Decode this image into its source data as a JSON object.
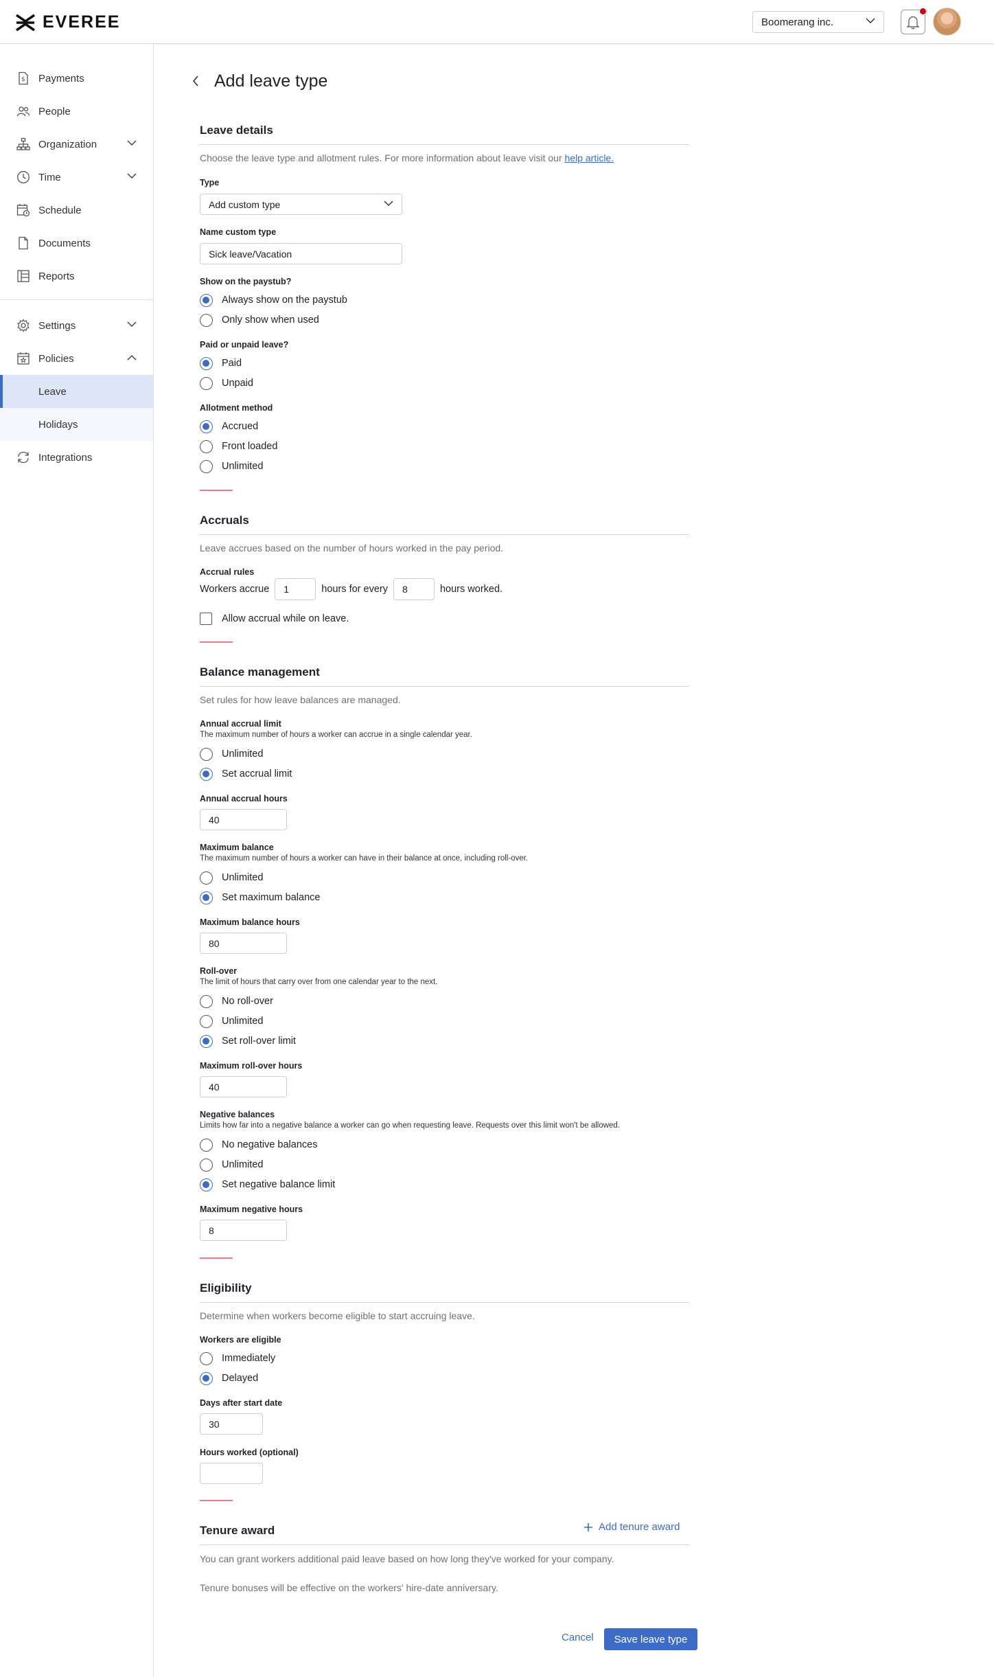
{
  "header": {
    "logo_text": "EVEREE",
    "company": "Boomerang inc."
  },
  "sidebar": {
    "items": [
      {
        "label": "Payments",
        "icon": "document-dollar-icon"
      },
      {
        "label": "People",
        "icon": "people-icon"
      },
      {
        "label": "Organization",
        "icon": "org-chart-icon"
      },
      {
        "label": "Time",
        "icon": "clock-icon"
      },
      {
        "label": "Schedule",
        "icon": "calendar-clock-icon"
      },
      {
        "label": "Documents",
        "icon": "document-icon"
      },
      {
        "label": "Reports",
        "icon": "table-icon"
      },
      {
        "label": "Settings",
        "icon": "gear-icon"
      },
      {
        "label": "Policies",
        "icon": "calendar-star-icon"
      },
      {
        "label": "Integrations",
        "icon": "sync-icon"
      }
    ],
    "policies_sub": [
      {
        "label": "Leave"
      },
      {
        "label": "Holidays"
      }
    ]
  },
  "page": {
    "title": "Add leave type"
  },
  "leave_details": {
    "title": "Leave details",
    "desc": "Choose the leave type and allotment rules. For more information about leave visit our ",
    "link": "help article.",
    "type_label": "Type",
    "type_value": "Add custom type",
    "name_label": "Name custom type",
    "name_value": "Sick leave/Vacation",
    "paystub_label": "Show on the paystub?",
    "paystub_options": [
      "Always show on the paystub",
      "Only show when used"
    ],
    "paid_label": "Paid or unpaid leave?",
    "paid_options": [
      "Paid",
      "Unpaid"
    ],
    "allotment_label": "Allotment method",
    "allotment_options": [
      "Accrued",
      "Front loaded",
      "Unlimited"
    ]
  },
  "accruals": {
    "title": "Accruals",
    "desc": "Leave accrues based on the number of hours worked in the pay period.",
    "rules_label": "Accrual rules",
    "text_1": "Workers accrue",
    "hours_value": "1",
    "text_2": "hours for every",
    "every_value": "8",
    "text_3": "hours worked.",
    "allow_label": "Allow accrual while on leave."
  },
  "balance": {
    "title": "Balance management",
    "desc": "Set rules for how leave balances are managed.",
    "annual_label": "Annual accrual limit",
    "annual_hint": "The maximum number of hours a worker can accrue in a single calendar year.",
    "annual_options": [
      "Unlimited",
      "Set accrual limit"
    ],
    "annual_hours_label": "Annual accrual hours",
    "annual_hours_value": "40",
    "max_label": "Maximum balance",
    "max_hint": "The maximum number of hours a worker can have in their balance at once, including roll-over.",
    "max_options": [
      "Unlimited",
      "Set maximum balance"
    ],
    "max_hours_label": "Maximum balance hours",
    "max_hours_value": "80",
    "rollover_label": "Roll-over",
    "rollover_hint": "The limit of hours that carry over from one calendar year to the next.",
    "rollover_options": [
      "No roll-over",
      "Unlimited",
      "Set roll-over limit"
    ],
    "rollover_hours_label": "Maximum roll-over hours",
    "rollover_hours_value": "40",
    "negative_label": "Negative balances",
    "negative_hint": "Limits how far into a negative balance a worker can go when requesting leave. Requests over this limit won't be allowed.",
    "negative_options": [
      "No negative balances",
      "Unlimited",
      "Set negative balance limit"
    ],
    "negative_hours_label": "Maximum negative hours",
    "negative_hours_value": "8"
  },
  "eligibility": {
    "title": "Eligibility",
    "desc": "Determine when workers become eligible to start accruing leave.",
    "workers_label": "Workers are eligible",
    "workers_options": [
      "Immediately",
      "Delayed"
    ],
    "days_label": "Days after start date",
    "days_value": "30",
    "hours_label": "Hours worked (optional)",
    "hours_value": ""
  },
  "tenure": {
    "title": "Tenure award",
    "add_label": "Add tenure award",
    "desc_1": "You can grant workers additional paid leave based on how long they've worked for your company.",
    "desc_2": "Tenure bonuses will be effective on the workers' hire-date anniversary."
  },
  "footer": {
    "cancel_label": "Cancel",
    "save_label": "Save leave type"
  },
  "colors": {
    "accent": "#3d6bc8",
    "alert": "#d0021b",
    "section_marker": "#e57b8e"
  }
}
